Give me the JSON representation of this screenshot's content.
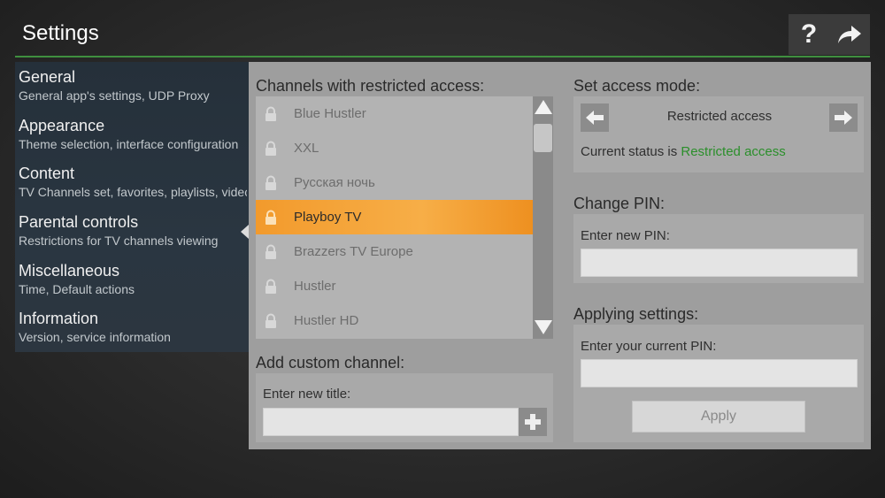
{
  "header": {
    "title": "Settings",
    "help_icon": "question-mark-icon",
    "forward_icon": "share-forward-icon"
  },
  "colors": {
    "accent_line": "#3f8f3f",
    "selection": "#f29a2c",
    "status_ok": "#2b8f2b"
  },
  "sidebar": {
    "items": [
      {
        "title": "General",
        "subtitle": "General app's settings, UDP Proxy"
      },
      {
        "title": "Appearance",
        "subtitle": "Theme selection, interface configuration"
      },
      {
        "title": "Content",
        "subtitle": "TV Channels set, favorites, playlists, video"
      },
      {
        "title": "Parental controls",
        "subtitle": "Restrictions for TV channels viewing",
        "selected": true
      },
      {
        "title": "Miscellaneous",
        "subtitle": "Time, Default actions"
      },
      {
        "title": "Information",
        "subtitle": "Version, service information"
      }
    ]
  },
  "restricted": {
    "heading": "Channels with restricted access:",
    "channels": [
      {
        "name": "Blue Hustler",
        "selected": false
      },
      {
        "name": "XXL",
        "selected": false
      },
      {
        "name": "Русская ночь",
        "selected": false
      },
      {
        "name": "Playboy TV",
        "selected": true
      },
      {
        "name": "Brazzers TV Europe",
        "selected": false
      },
      {
        "name": "Hustler",
        "selected": false
      },
      {
        "name": "Hustler HD",
        "selected": false
      }
    ]
  },
  "custom": {
    "heading": "Add custom channel:",
    "field_label": "Enter new title:",
    "value": ""
  },
  "access_mode": {
    "heading": "Set access mode:",
    "mode": "Restricted access",
    "status_prefix": "Current status is ",
    "status_value": "Restricted access"
  },
  "change_pin": {
    "heading": "Change PIN:",
    "field_label": "Enter new PIN:",
    "value": ""
  },
  "applying": {
    "heading": "Applying settings:",
    "field_label": "Enter your current PIN:",
    "value": "",
    "apply_label": "Apply"
  }
}
